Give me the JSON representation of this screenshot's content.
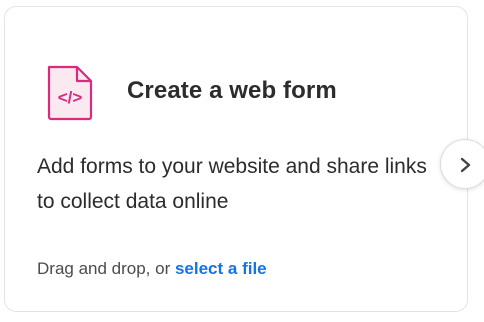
{
  "card": {
    "title": "Create a web form",
    "description": "Add forms to your website and share links to collect data online",
    "drop_hint_prefix": "Drag and drop, or ",
    "drop_hint_link": "select a file",
    "icon": "web-form-file-icon",
    "icon_glyph": "</>"
  },
  "navigation": {
    "next_icon": "chevron-right-icon"
  },
  "colors": {
    "accent_magenta": "#d92a7c",
    "icon_background": "#fbe9f1",
    "link_blue": "#1473e6",
    "text_dark": "#2c2c2c"
  }
}
